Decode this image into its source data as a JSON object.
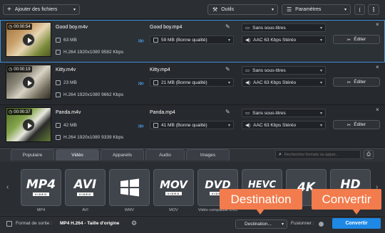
{
  "toolbar": {
    "add_files_label": "Ajouter des fichiers",
    "tools_label": "Outils",
    "settings_label": "Paramètres"
  },
  "files": [
    {
      "duration": "00:00:54",
      "source_name": "Good boy.m4v",
      "source_size": "63 MB",
      "source_specs": "H.264 1920x1080 9582 Kbps",
      "output_name": "Good boy.mp4",
      "output_size": "59 MB (Bonne qualité)",
      "subtitles": "Sans sous-titres",
      "audio": "AAC 63 Kbps Stéréo",
      "edit_label": "Éditer",
      "selected": true
    },
    {
      "duration": "00:00:19",
      "source_name": "Kitty.m4v",
      "source_size": "23 MB",
      "source_specs": "H.264 1920x1080 9662 Kbps",
      "output_name": "Kitty.mp4",
      "output_size": "21 MB (Bonne qualité)",
      "subtitles": "Sans sous-titres",
      "audio": "AAC 63 Kbps Stéréo",
      "edit_label": "Éditer",
      "selected": false
    },
    {
      "duration": "00:00:37",
      "source_name": "Panda.m4v",
      "source_size": "42 MB",
      "source_specs": "H.264 1920x1080 9339 Kbps",
      "output_name": "Panda.mp4",
      "output_size": "41 MB (Bonne qualité)",
      "subtitles": "Sans sous-titres",
      "audio": "AAC 63 Kbps Stéréo",
      "edit_label": "Éditer",
      "selected": false
    }
  ],
  "tabs": [
    "Populaire",
    "Vidéo",
    "Appareils",
    "Audio",
    "Images"
  ],
  "active_tab": "Vidéo",
  "search": {
    "placeholder": "Rechercher formats ou appar..."
  },
  "formats": [
    {
      "logo": "MP4",
      "sub": "VIDEO",
      "label": "MP4"
    },
    {
      "logo": "AVI",
      "sub": "VIDEO",
      "label": "AVI"
    },
    {
      "logo": "",
      "sub": "",
      "label": "WMV"
    },
    {
      "logo": "MOV",
      "sub": "VIDEO",
      "label": "MOV"
    },
    {
      "logo": "DVD",
      "sub": "VIDEO",
      "label": "Vidéo compatible DVD"
    },
    {
      "logo": "HEVC",
      "sub": "VIDEO",
      "label": ""
    },
    {
      "logo": "4K",
      "sub": "",
      "label": ""
    },
    {
      "logo": "HD",
      "sub": "VIDEO",
      "label": ""
    }
  ],
  "footer": {
    "output_format_label": "Format de sortie :",
    "output_format_value": "MP4 H.264 - Taille d'origine",
    "destination_label": "Destination...",
    "merge_label": "Fusionner :",
    "convert_label": "Convertir"
  },
  "callouts": {
    "destination": "Destination",
    "convert": "Convertir"
  },
  "colors": {
    "accent": "#1e88e5",
    "callout": "#f27c4d",
    "selection": "#3c8fd8"
  }
}
